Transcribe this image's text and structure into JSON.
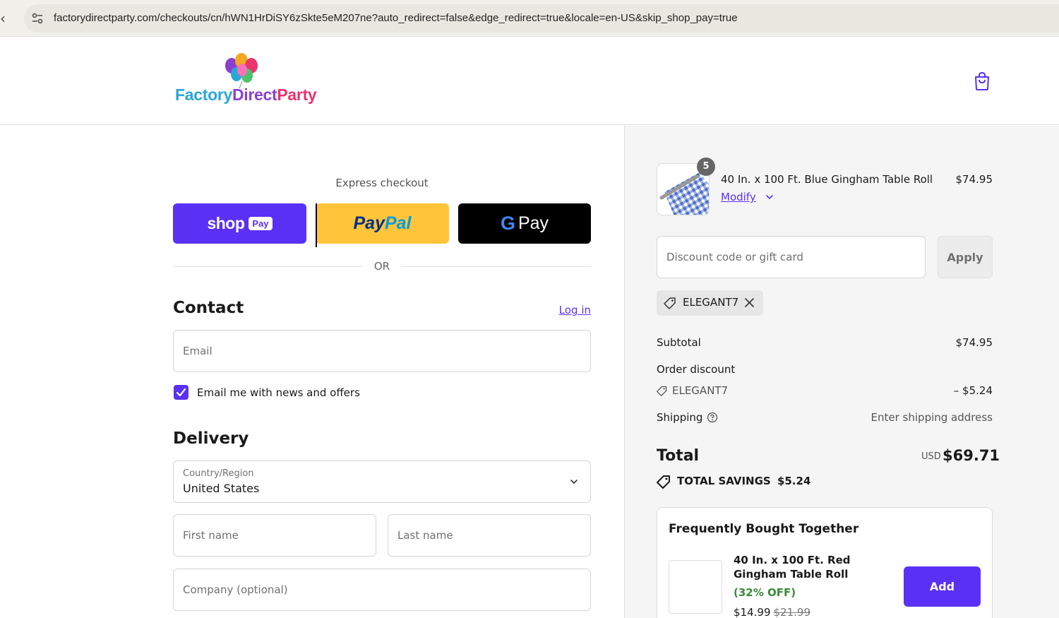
{
  "browser": {
    "url": "factorydirectparty.com/checkouts/cn/hWN1HrDiSY6zSkte5eM207ne?auto_redirect=false&edge_redirect=true&locale=en-US&skip_shop_pay=true"
  },
  "header": {
    "logo": {
      "part1": "Factory",
      "part2": "Direct",
      "part3": "Party"
    }
  },
  "express": {
    "label": "Express checkout",
    "shop_word": "shop",
    "shop_badge": "Pay",
    "paypal_word_1": "Pay",
    "paypal_word_2": "Pal",
    "gpay_g": "G",
    "gpay_word": "Pay",
    "or_text": "OR"
  },
  "contact": {
    "title": "Contact",
    "login_label": "Log in",
    "email_placeholder": "Email",
    "newsletter_label": "Email me with news and offers",
    "newsletter_checked": true
  },
  "delivery": {
    "title": "Delivery",
    "country_label": "Country/Region",
    "country_value": "United States",
    "first_name_placeholder": "First name",
    "last_name_placeholder": "Last name",
    "company_placeholder": "Company (optional)"
  },
  "cart": {
    "item": {
      "quantity": "5",
      "title": "40 In. x 100 Ft. Blue Gingham Table Roll",
      "price": "$74.95",
      "modify_label": "Modify"
    },
    "discount_placeholder": "Discount code or gift card",
    "apply_label": "Apply",
    "applied_code": "ELEGANT7",
    "summary": {
      "subtotal_label": "Subtotal",
      "subtotal_value": "$74.95",
      "order_discount_label": "Order discount",
      "discount_code": "ELEGANT7",
      "discount_value": "– $5.24",
      "shipping_label": "Shipping",
      "shipping_value": "Enter shipping address",
      "total_label": "Total",
      "total_currency": "USD",
      "total_value": "$69.71",
      "savings_label": "TOTAL SAVINGS",
      "savings_value": "$5.24"
    },
    "fbt": {
      "title": "Frequently Bought Together",
      "item_name": "40 In. x 100 Ft. Red Gingham Table Roll",
      "discount": "(32% OFF)",
      "price": "$14.99",
      "old_price": "$21.99",
      "add_label": "Add"
    }
  },
  "colors": {
    "accent": "#5a31f4",
    "paypal": "#ffc439",
    "savings_green": "#3a8a3a"
  }
}
